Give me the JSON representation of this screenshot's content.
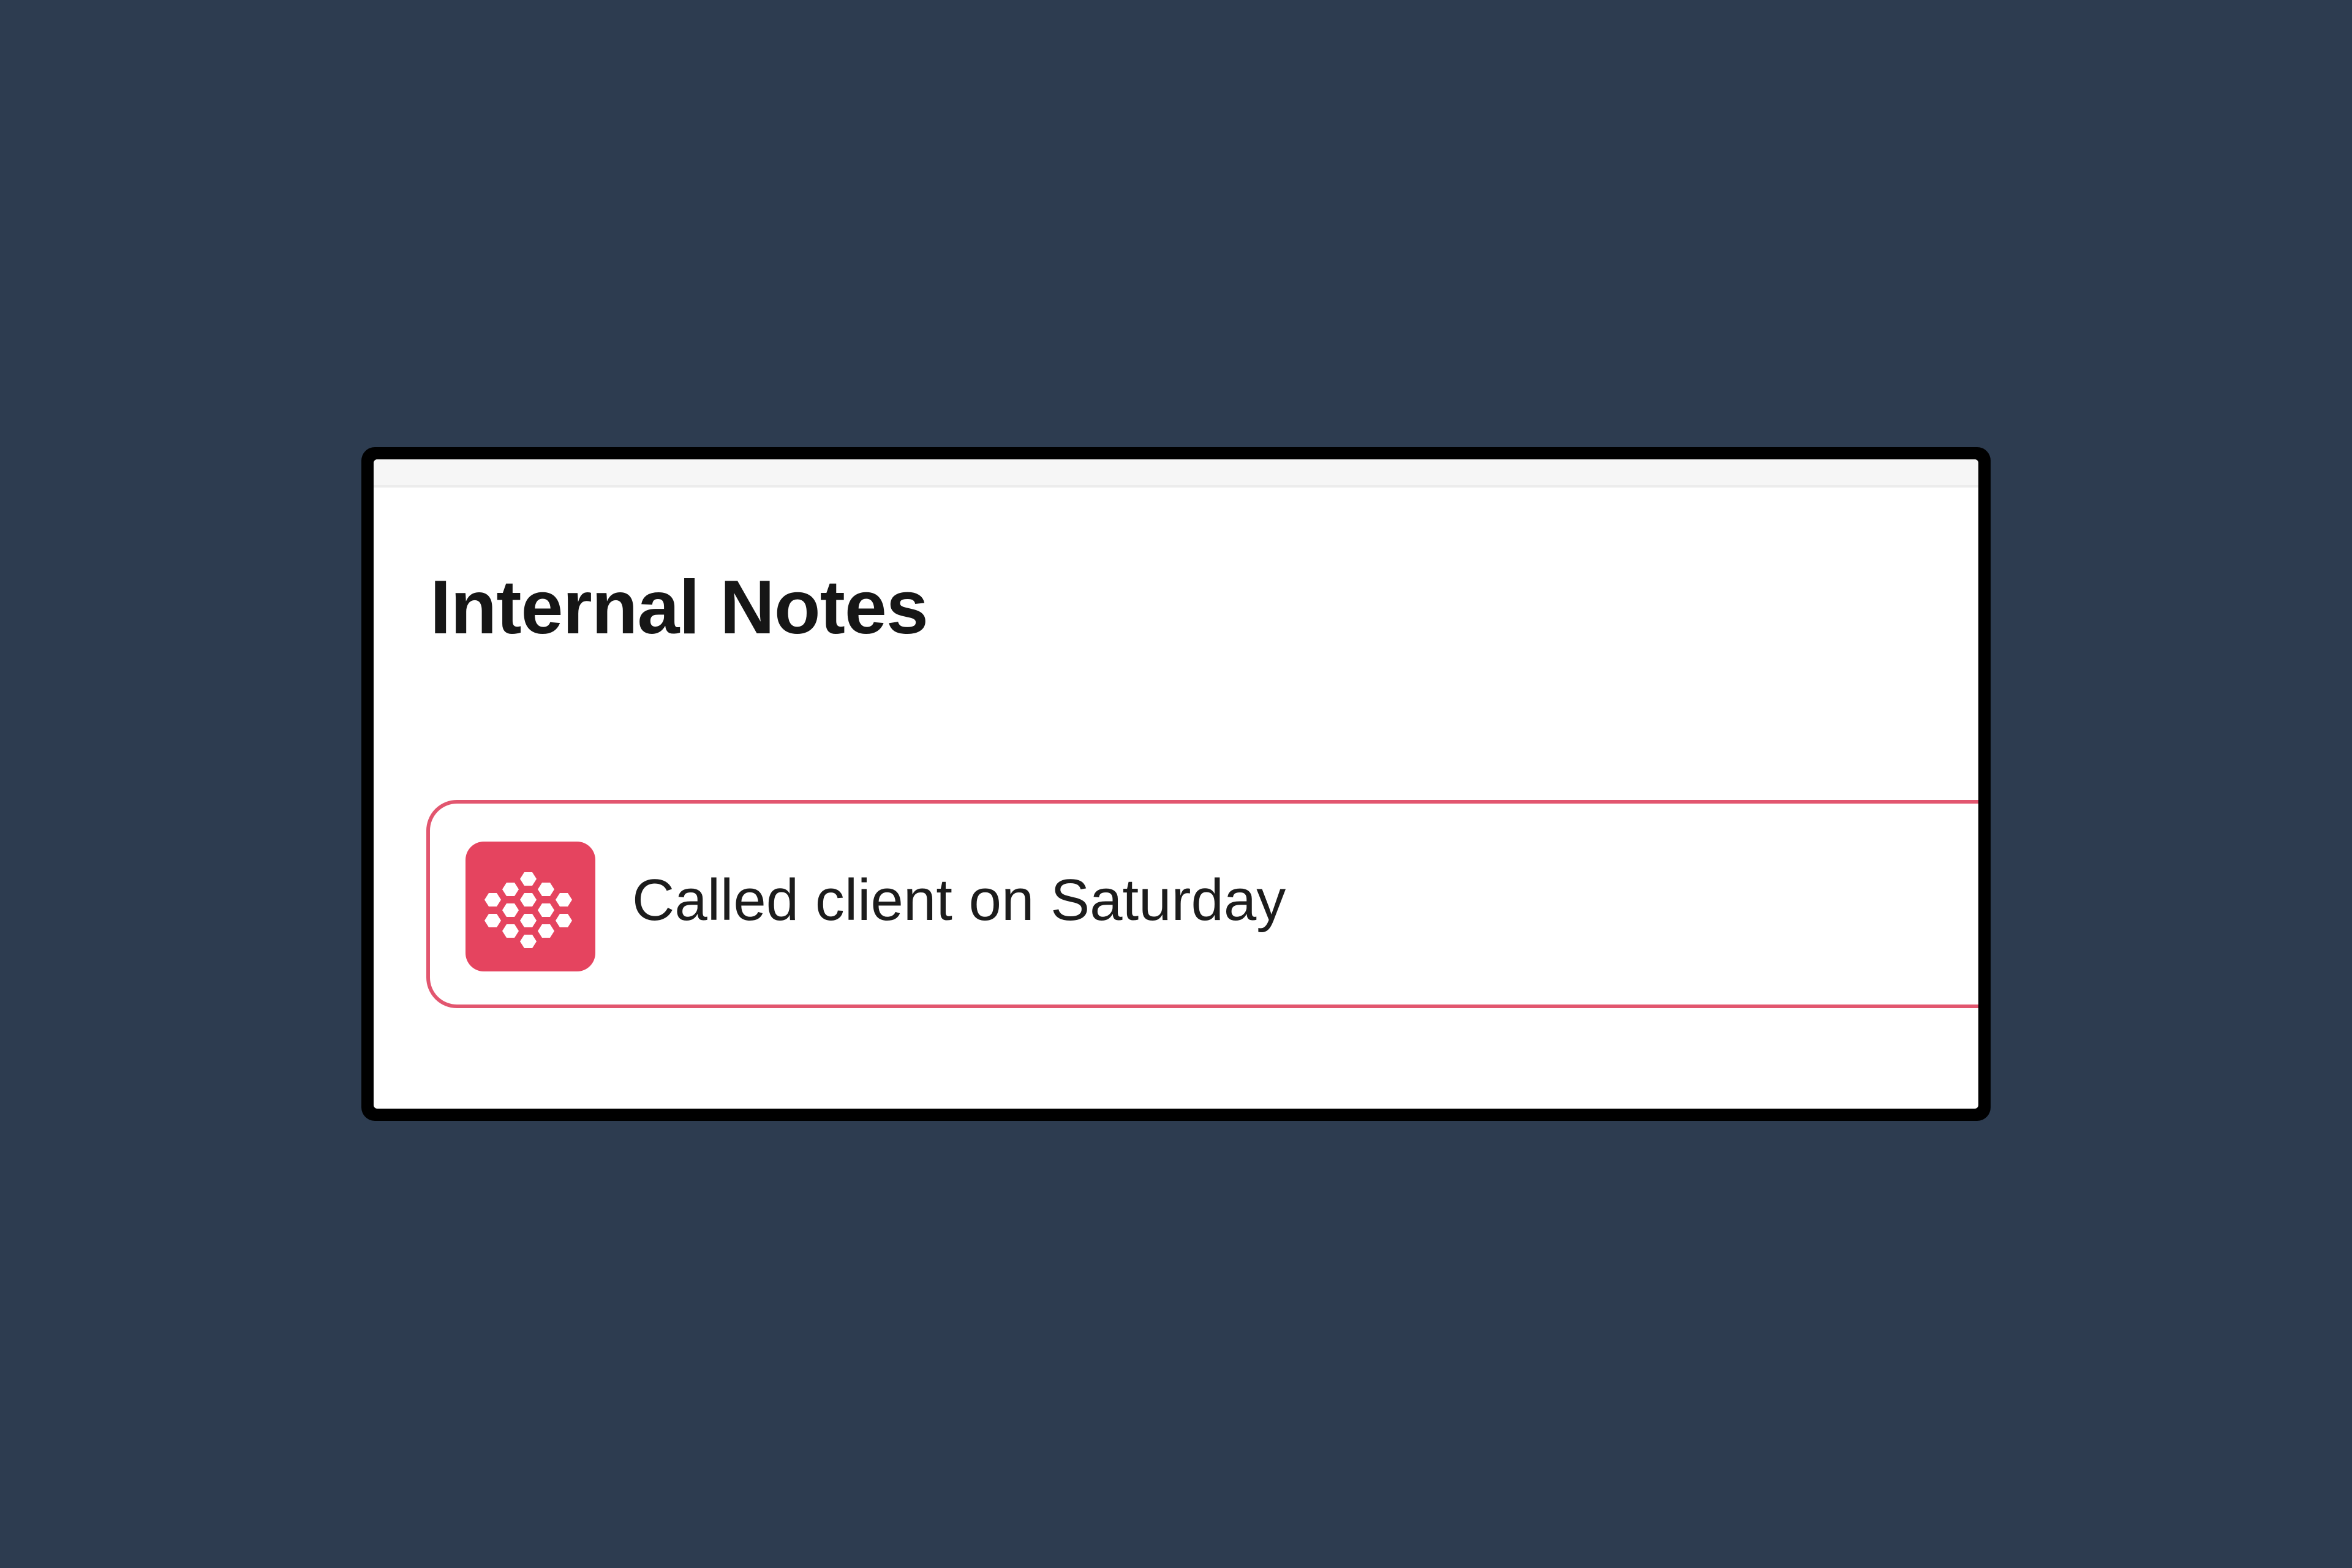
{
  "panel": {
    "title": "Internal Notes"
  },
  "note": {
    "text": "Called client on Saturday",
    "icon": "honeycomb-icon",
    "accent_color": "#e2566f",
    "icon_background": "#e5445f"
  },
  "colors": {
    "page_background": "#2d3c50",
    "window_frame": "#000000",
    "window_background": "#ffffff"
  }
}
